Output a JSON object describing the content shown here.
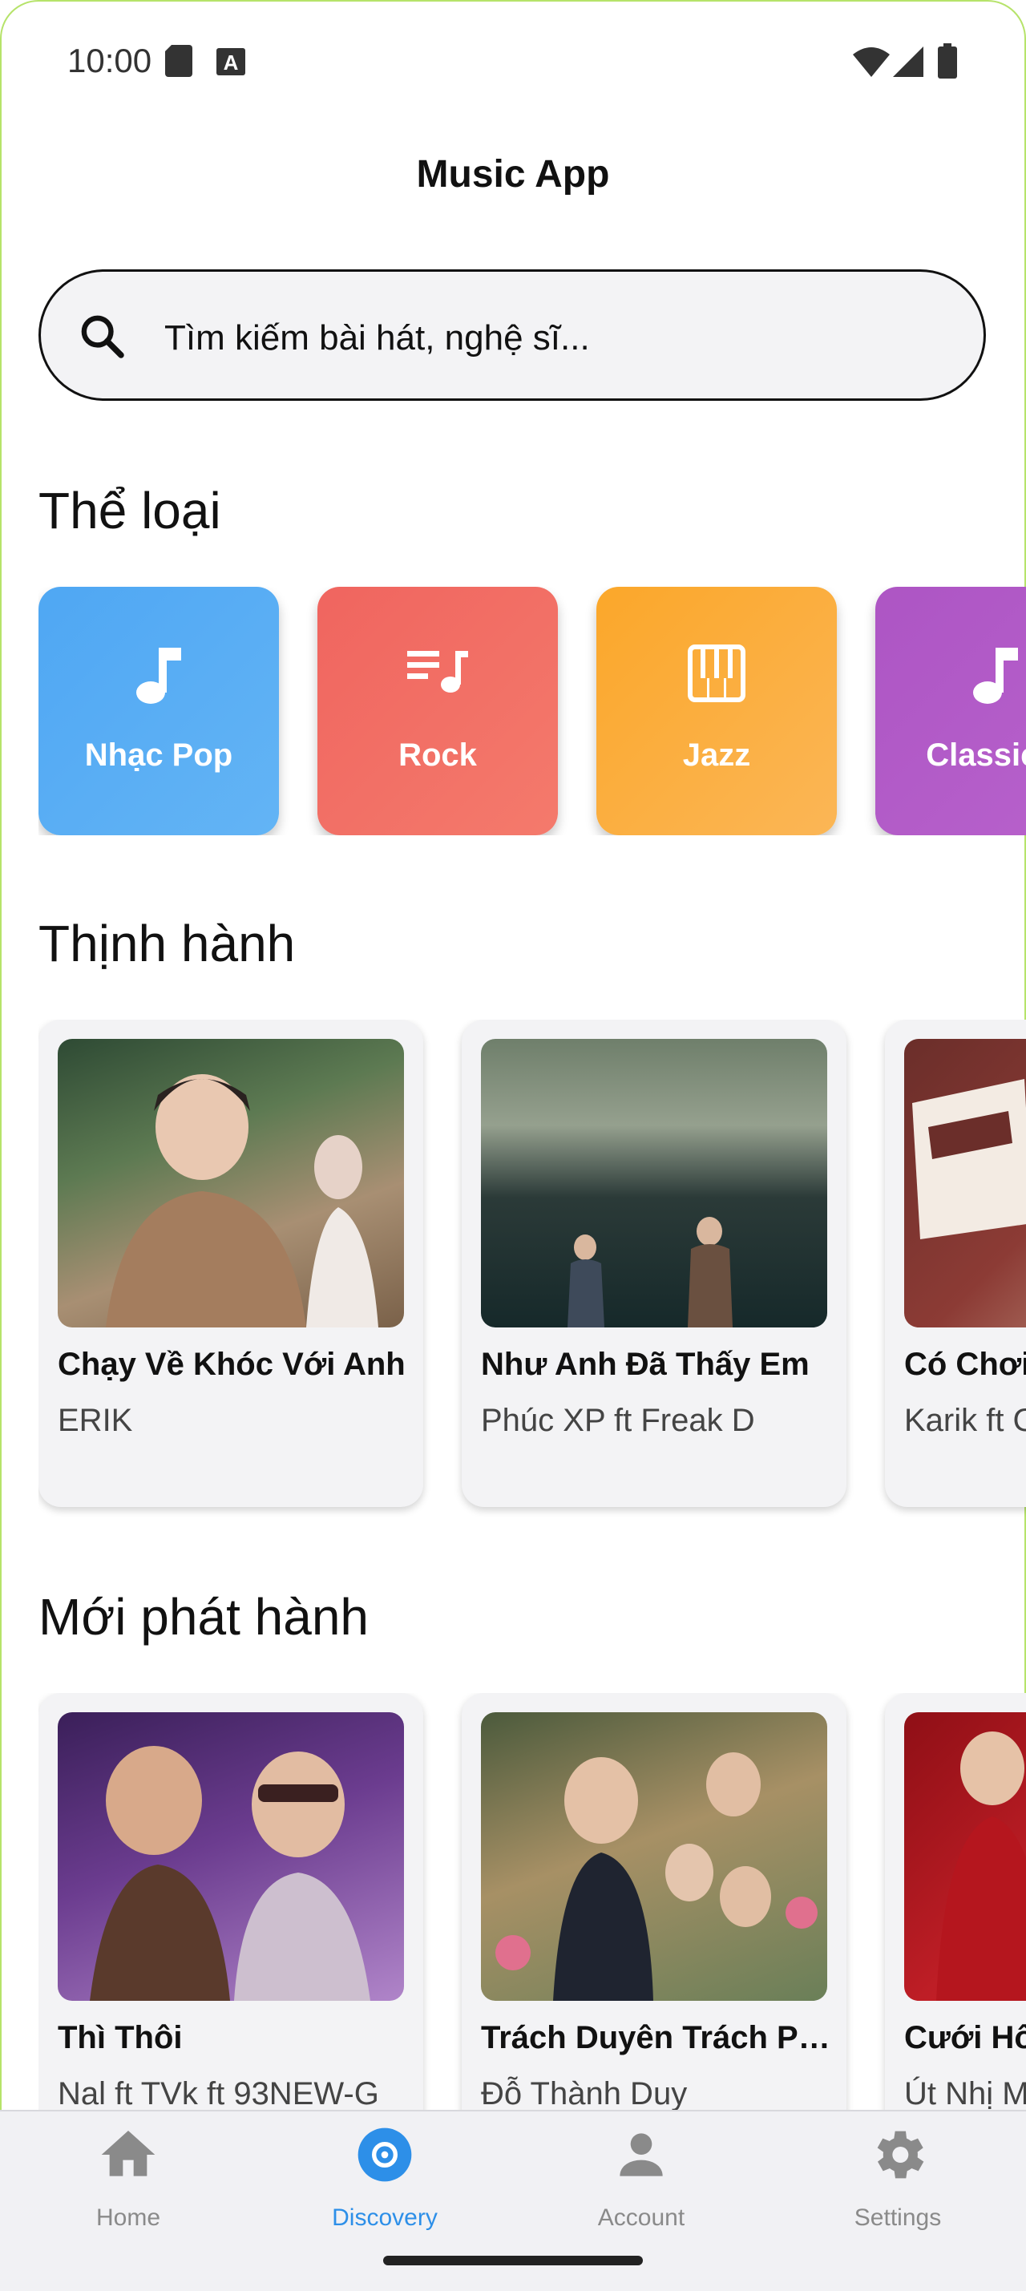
{
  "status_bar": {
    "time": "10:00"
  },
  "app_title": "Music App",
  "search": {
    "placeholder": "Tìm kiếm bài hát, nghệ sĩ..."
  },
  "sections": {
    "genres_title": "Thể loại",
    "trending_title": "Thịnh hành",
    "new_releases_title": "Mới phát hành"
  },
  "genres": [
    {
      "label": "Nhạc Pop",
      "icon": "music-note-icon",
      "color": "#4fa7f3"
    },
    {
      "label": "Rock",
      "icon": "playlist-icon",
      "color": "#f0655f"
    },
    {
      "label": "Jazz",
      "icon": "piano-icon",
      "color": "#fba72a"
    },
    {
      "label": "Classical",
      "icon": "music-note-icon",
      "color": "#ad55c4"
    }
  ],
  "trending": [
    {
      "title": "Chạy Về Khóc Với Anh",
      "artist": "ERIK"
    },
    {
      "title": "Như Anh Đã Thấy Em",
      "artist": "Phúc XP ft Freak D"
    },
    {
      "title": "Có Chơi Có Chịu",
      "artist": "Karik ft Only C"
    }
  ],
  "new_releases": [
    {
      "title": "Thì Thôi",
      "artist": "Nal ft TVk ft 93NEW-G"
    },
    {
      "title": "Trách Duyên Trách Phận",
      "artist": "Đỗ Thành Duy"
    },
    {
      "title": "Cưới Hông Chốt Nha",
      "artist": "Út Nhị Mino"
    }
  ],
  "bottom_nav": [
    {
      "label": "Home",
      "icon": "home-icon"
    },
    {
      "label": "Discovery",
      "icon": "disc-icon",
      "active": true
    },
    {
      "label": "Account",
      "icon": "person-icon"
    },
    {
      "label": "Settings",
      "icon": "gear-icon"
    }
  ],
  "colors": {
    "accent": "#2d8fe8",
    "nav_bg": "#f1f1f4",
    "card_bg": "#f3f3f5"
  }
}
